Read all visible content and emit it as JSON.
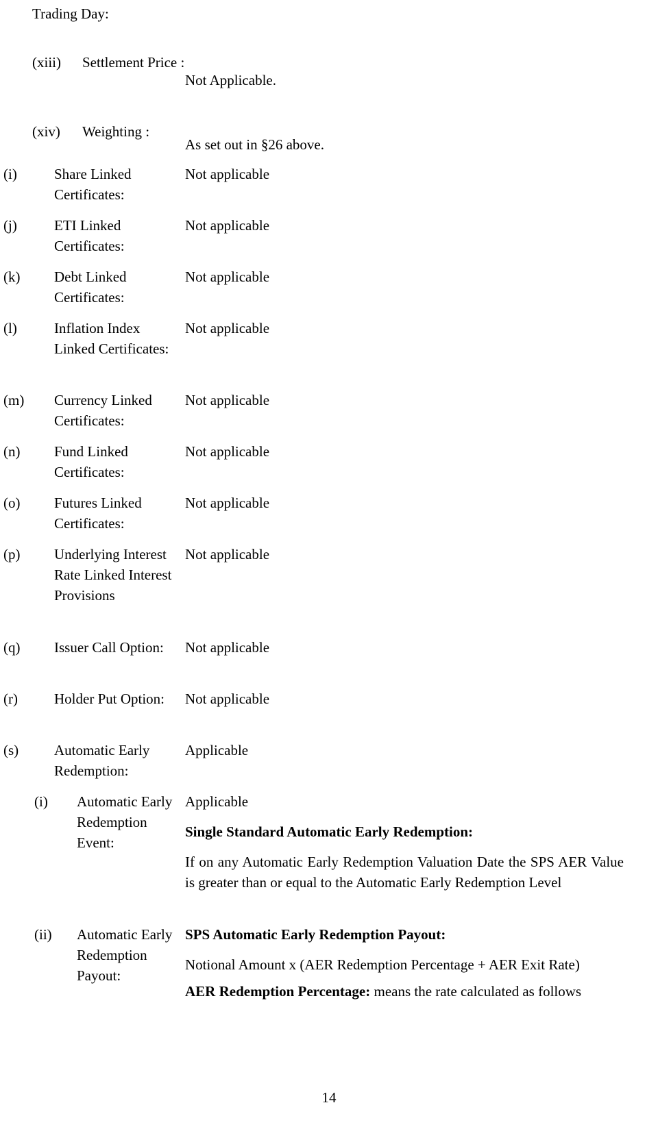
{
  "document": {
    "heading": "Trading Day:",
    "page_number": "14",
    "rows": [
      {
        "num": "(xiii)",
        "label": "Settlement Price :",
        "value": "Not Applicable."
      },
      {
        "num": "(xiv)",
        "label": "Weighting :",
        "value": "As set out in §26 above."
      },
      {
        "num": "(i)",
        "label": "Share Linked Certificates:",
        "value": "Not applicable"
      },
      {
        "num": "(j)",
        "label": "ETI Linked Certificates:",
        "value": "Not applicable"
      },
      {
        "num": "(k)",
        "label": "Debt Linked Certificates:",
        "value": "Not applicable"
      },
      {
        "num": "(l)",
        "label": "Inflation Index Linked Certificates:",
        "value": "Not applicable"
      },
      {
        "num": "(m)",
        "label": "Currency Linked Certificates:",
        "value": "Not applicable"
      },
      {
        "num": "(n)",
        "label": "Fund Linked Certificates:",
        "value": "Not applicable"
      },
      {
        "num": "(o)",
        "label": "Futures Linked Certificates:",
        "value": "Not applicable"
      },
      {
        "num": "(p)",
        "label": "Underlying Interest Rate Linked Interest Provisions",
        "value": "Not applicable"
      },
      {
        "num": "(q)",
        "label": "Issuer Call Option:",
        "value": "Not applicable"
      },
      {
        "num": "(r)",
        "label": "Holder Put Option:",
        "value": "Not applicable"
      },
      {
        "num": "(s)",
        "label": "Automatic Early Redemption:",
        "value": "Applicable"
      }
    ],
    "subrows": [
      {
        "num": "(i)",
        "label": "Automatic Early Redemption Event:",
        "value_line1": "Applicable",
        "value_heading": "Single Standard Automatic Early Redemption:",
        "value_body": "If on any Automatic Early Redemption Valuation Date the SPS AER Value is greater than or equal to the Automatic Early Redemption Level"
      },
      {
        "num": "(ii)",
        "label": "Automatic Early Redemption Payout:",
        "value_heading": "SPS Automatic Early Redemption Payout:",
        "value_body": "Notional Amount x (AER Redemption Percentage + AER Exit Rate)",
        "value_tail_bold": "AER Redemption Percentage:",
        "value_tail_rest": " means the rate calculated as follows"
      }
    ]
  }
}
